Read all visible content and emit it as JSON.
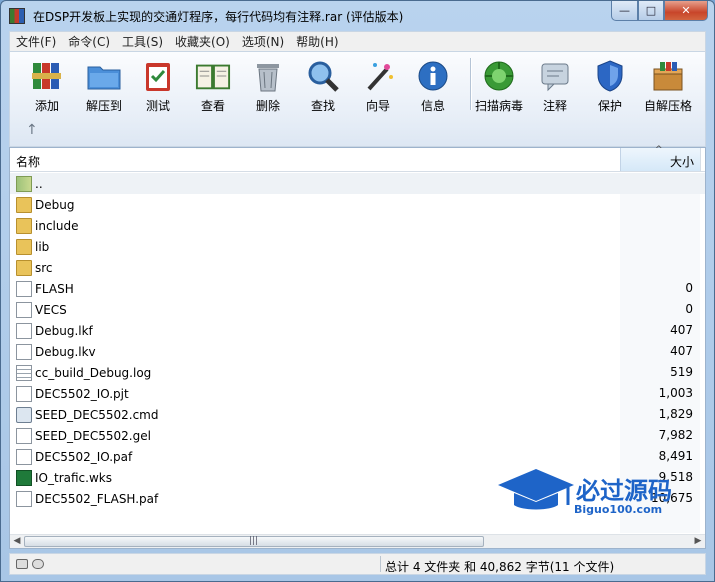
{
  "window": {
    "title": "在DSP开发板上实现的交通灯程序，每行代码均有注释.rar (评估版本)",
    "buttons": {
      "minimize": "—",
      "maximize": "□",
      "close": "✕"
    }
  },
  "menu": [
    "文件(F)",
    "命令(C)",
    "工具(S)",
    "收藏夹(O)",
    "选项(N)",
    "帮助(H)"
  ],
  "toolbar": {
    "tools": [
      {
        "label": "添加",
        "icon": "add-books-icon"
      },
      {
        "label": "解压到",
        "icon": "extract-folder-icon"
      },
      {
        "label": "测试",
        "icon": "test-clipboard-icon"
      },
      {
        "label": "查看",
        "icon": "view-book-icon"
      },
      {
        "label": "删除",
        "icon": "trash-icon"
      },
      {
        "label": "查找",
        "icon": "find-magnifier-icon"
      },
      {
        "label": "向导",
        "icon": "wizard-wand-icon"
      },
      {
        "label": "信息",
        "icon": "info-icon"
      },
      {
        "label": "扫描病毒",
        "icon": "virus-scan-icon"
      },
      {
        "label": "注释",
        "icon": "comment-icon"
      },
      {
        "label": "保护",
        "icon": "shield-icon"
      },
      {
        "label": "自解压格",
        "icon": "sfx-box-icon"
      }
    ],
    "up_label": "↑"
  },
  "filelist": {
    "headers": {
      "name": "名称",
      "size": "大小"
    },
    "rows": [
      {
        "name": "..",
        "size": "",
        "kind": "folder-up"
      },
      {
        "name": "Debug",
        "size": "",
        "kind": "folder"
      },
      {
        "name": "include",
        "size": "",
        "kind": "folder"
      },
      {
        "name": "lib",
        "size": "",
        "kind": "folder"
      },
      {
        "name": "src",
        "size": "",
        "kind": "folder"
      },
      {
        "name": "FLASH",
        "size": "0",
        "kind": "doc"
      },
      {
        "name": "VECS",
        "size": "0",
        "kind": "doc"
      },
      {
        "name": "Debug.lkf",
        "size": "407",
        "kind": "doc"
      },
      {
        "name": "Debug.lkv",
        "size": "407",
        "kind": "doc"
      },
      {
        "name": "cc_build_Debug.log",
        "size": "519",
        "kind": "doc-lines"
      },
      {
        "name": "DEC5502_IO.pjt",
        "size": "1,003",
        "kind": "doc"
      },
      {
        "name": "SEED_DEC5502.cmd",
        "size": "1,829",
        "kind": "doc-gear"
      },
      {
        "name": "SEED_DEC5502.gel",
        "size": "7,982",
        "kind": "doc"
      },
      {
        "name": "DEC5502_IO.paf",
        "size": "8,491",
        "kind": "doc"
      },
      {
        "name": "IO_trafic.wks",
        "size": "9,518",
        "kind": "doc-xl"
      },
      {
        "name": "DEC5502_FLASH.paf",
        "size": "10,675",
        "kind": "doc"
      }
    ]
  },
  "status": {
    "summary": "总计 4 文件夹 和 40,862 字节(11 个文件)"
  },
  "watermark": {
    "text": "必过源码",
    "url": "Biguo100.com"
  }
}
